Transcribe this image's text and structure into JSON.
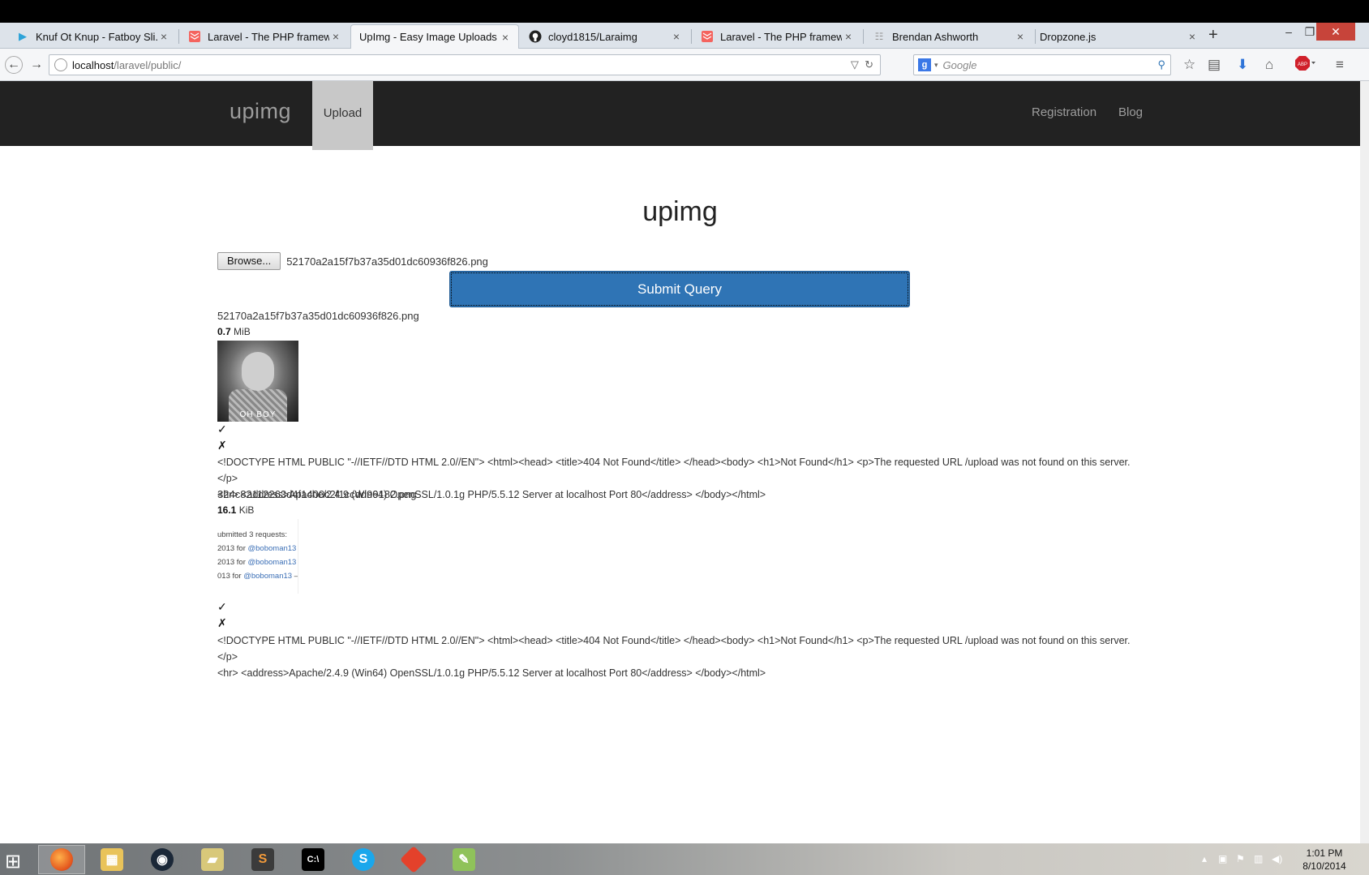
{
  "browser": {
    "tabs": [
      {
        "title": "Knuf Ot Knup - Fatboy Sli...",
        "icon": "google-play-icon",
        "active": false
      },
      {
        "title": "Laravel - The PHP framew...",
        "icon": "laravel-icon",
        "active": false
      },
      {
        "title": "UpImg - Easy Image Uploads",
        "icon": "",
        "active": true
      },
      {
        "title": "cloyd1815/Laraimg",
        "icon": "github-icon",
        "active": false
      },
      {
        "title": "Laravel - The PHP framew...",
        "icon": "laravel-icon",
        "active": false
      },
      {
        "title": "Brendan Ashworth",
        "icon": "page-icon",
        "active": false
      },
      {
        "title": "Dropzone.js",
        "icon": "",
        "active": false
      }
    ],
    "new_tab": "+",
    "url_host": "localhost",
    "url_path": "/laravel/public/",
    "search_engine": "g",
    "search_placeholder": "Google"
  },
  "site": {
    "brand": "upimg",
    "nav_upload": "Upload",
    "nav_registration": "Registration",
    "nav_blog": "Blog",
    "heading": "upimg"
  },
  "form": {
    "browse_label": "Browse...",
    "selected_file": "52170a2a15f7b37a35d01dc60936f826.png",
    "submit_label": "Submit Query"
  },
  "previews": [
    {
      "filename": "52170a2a15f7b37a35d01dc60936f826.png",
      "size_value": "0.7",
      "size_unit": "MiB",
      "thumb_caption": "OH BOY",
      "success_mark": "✓",
      "error_mark": "✗",
      "error_line1": "<!DOCTYPE HTML PUBLIC \"-//IETF//DTD HTML 2.0//EN\"> <html><head> <title>404 Not Found</title> </head><body> <h1>Not Found</h1> <p>The requested URL /upload was not found on this server.</p>",
      "error_line2": "<hr> <address>Apache/2.4.9 (Win64) OpenSSL/1.0.1g PHP/5.5.12 Server at localhost Port 80</address> </body></html>"
    },
    {
      "filename": "324c82112263d4f1400c2f1ccdd99182.png",
      "size_value": "16.1",
      "size_unit": "KiB",
      "thumb_lines": [
        {
          "prefix": "ubmitted 3 requests:",
          "link": "",
          "suffix": ""
        },
        {
          "prefix": "2013 for ",
          "link": "@boboman13",
          "suffix": " –"
        },
        {
          "prefix": "2013 for ",
          "link": "@boboman13",
          "suffix": " –"
        },
        {
          "prefix": "013 for ",
          "link": "@boboman13",
          "suffix": " – I"
        }
      ],
      "success_mark": "✓",
      "error_mark": "✗",
      "error_line1": "<!DOCTYPE HTML PUBLIC \"-//IETF//DTD HTML 2.0//EN\"> <html><head> <title>404 Not Found</title> </head><body> <h1>Not Found</h1> <p>The requested URL /upload was not found on this server.</p>",
      "error_line2": "<hr> <address>Apache/2.4.9 (Win64) OpenSSL/1.0.1g PHP/5.5.12 Server at localhost Port 80</address> </body></html>"
    }
  ],
  "taskbar": {
    "apps": [
      "firefox-icon",
      "file-explorer-icon",
      "steam-icon",
      "folder-icon",
      "sublime-text-icon",
      "command-prompt-icon",
      "skype-icon",
      "git-icon",
      "notepad-plus-plus-icon"
    ],
    "time": "1:01 PM",
    "date": "8/10/2014"
  },
  "colors": {
    "accent": "#2f74b5",
    "site_nav_bg": "#222222",
    "nav_active_bg": "#c8c8c8"
  }
}
